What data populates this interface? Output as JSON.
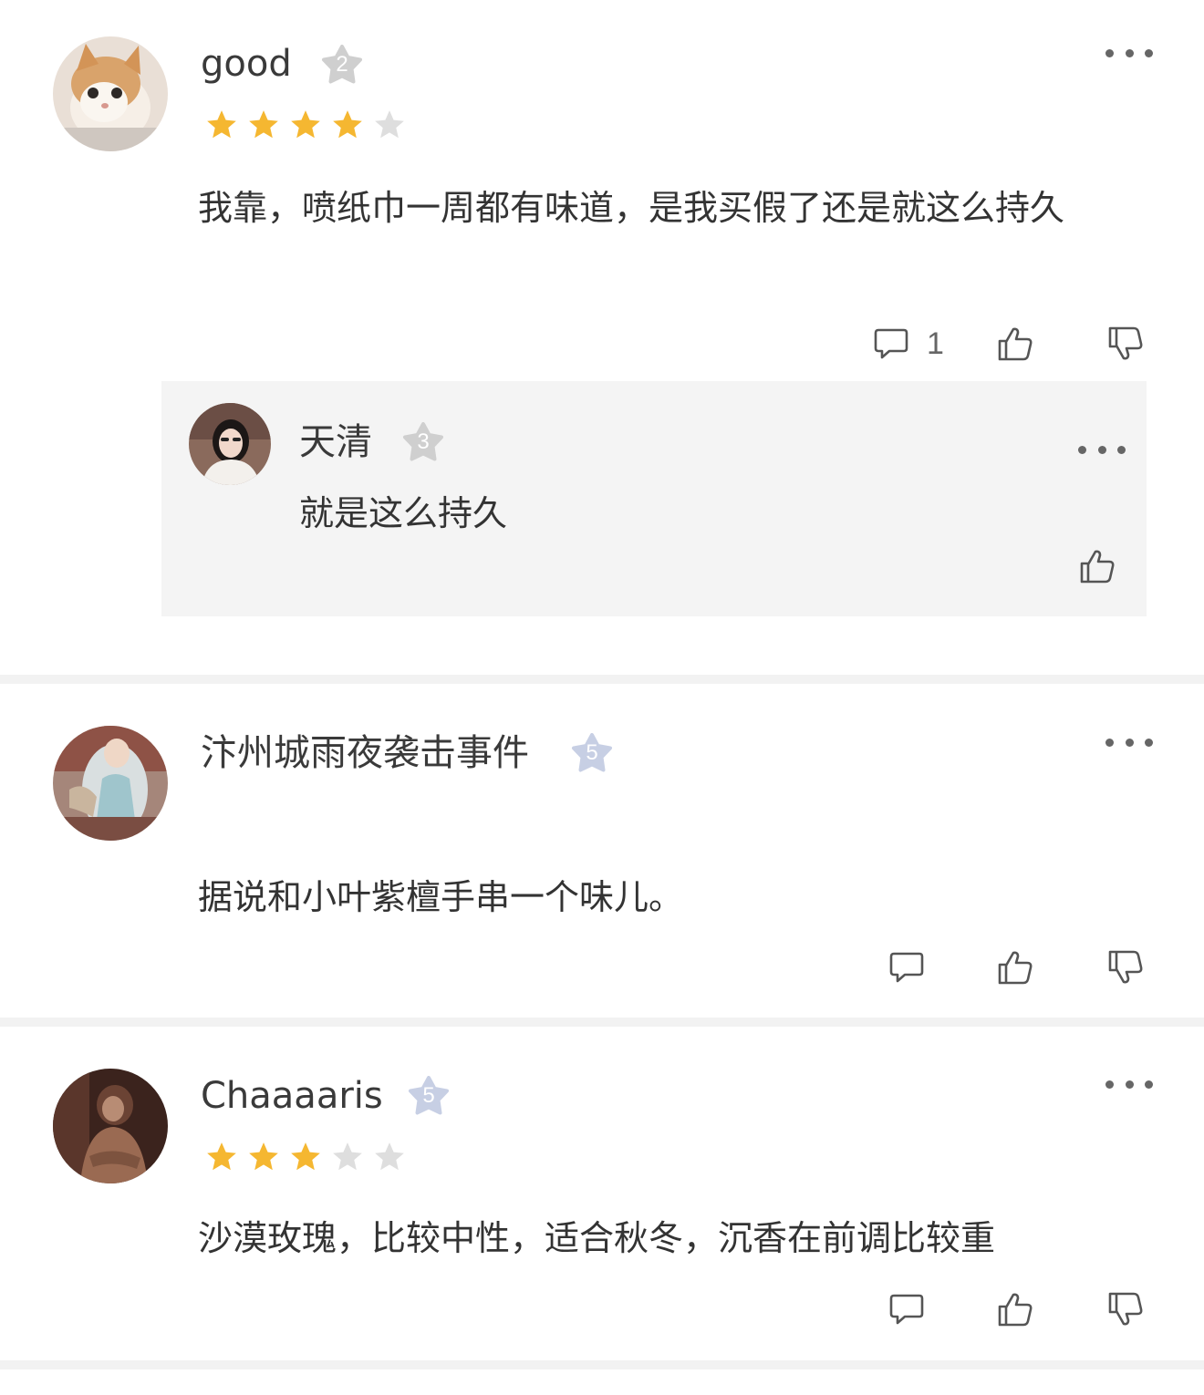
{
  "comments": [
    {
      "username": "good",
      "level": "2",
      "rating": 4,
      "text": "我靠，喷纸巾一周都有味道，是我买假了还是就这么持久",
      "reply_count": "1",
      "replies": [
        {
          "username": "天清",
          "level": "3",
          "text": "就是这么持久"
        }
      ]
    },
    {
      "username": "汴州城雨夜袭击事件",
      "level": "5",
      "text": "据说和小叶紫檀手串一个味儿。"
    },
    {
      "username": "Chaaaaris",
      "level": "5",
      "rating": 3,
      "text": "沙漠玫瑰，比较中性，适合秋冬，沉香在前调比较重"
    }
  ],
  "colors": {
    "star_filled": "#f5b731",
    "star_empty": "#dedede",
    "badge_gray": "#cfcfcf",
    "badge_blue": "#c7cfe4",
    "reply_background": "#f4f4f4"
  },
  "icons": [
    "more-icon",
    "comment-icon",
    "thumbs-up-icon",
    "thumbs-down-icon",
    "level-badge-icon",
    "star-icon"
  ]
}
